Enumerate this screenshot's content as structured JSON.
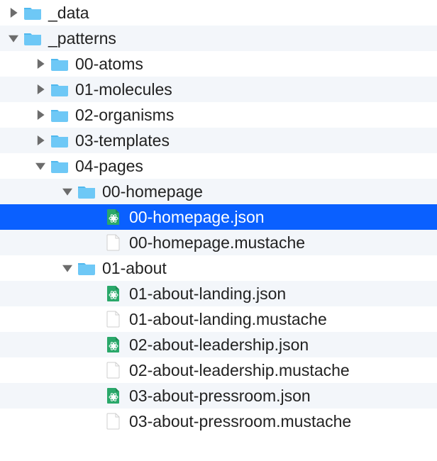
{
  "colors": {
    "selection": "#0a60ff",
    "folder": "#6ec8f6",
    "folder_tab": "#4fb8ee",
    "arrow": "#6c6c6c",
    "json_icon": "#2aa86a",
    "file_page": "#ffffff",
    "file_outline": "#cfcfcf",
    "row_stripe": "#f3f6fa"
  },
  "rows": [
    {
      "depth": 0,
      "arrow": "right",
      "icon": "folder",
      "label": "_data",
      "selected": false
    },
    {
      "depth": 0,
      "arrow": "down",
      "icon": "folder",
      "label": "_patterns",
      "selected": false
    },
    {
      "depth": 1,
      "arrow": "right",
      "icon": "folder",
      "label": "00-atoms",
      "selected": false
    },
    {
      "depth": 1,
      "arrow": "right",
      "icon": "folder",
      "label": "01-molecules",
      "selected": false
    },
    {
      "depth": 1,
      "arrow": "right",
      "icon": "folder",
      "label": "02-organisms",
      "selected": false
    },
    {
      "depth": 1,
      "arrow": "right",
      "icon": "folder",
      "label": "03-templates",
      "selected": false
    },
    {
      "depth": 1,
      "arrow": "down",
      "icon": "folder",
      "label": "04-pages",
      "selected": false
    },
    {
      "depth": 2,
      "arrow": "down",
      "icon": "folder",
      "label": "00-homepage",
      "selected": false
    },
    {
      "depth": 3,
      "arrow": "none",
      "icon": "json",
      "label": "00-homepage.json",
      "selected": true
    },
    {
      "depth": 3,
      "arrow": "none",
      "icon": "mustache",
      "label": "00-homepage.mustache",
      "selected": false
    },
    {
      "depth": 2,
      "arrow": "down",
      "icon": "folder",
      "label": "01-about",
      "selected": false
    },
    {
      "depth": 3,
      "arrow": "none",
      "icon": "json",
      "label": "01-about-landing.json",
      "selected": false
    },
    {
      "depth": 3,
      "arrow": "none",
      "icon": "mustache",
      "label": "01-about-landing.mustache",
      "selected": false
    },
    {
      "depth": 3,
      "arrow": "none",
      "icon": "json",
      "label": "02-about-leadership.json",
      "selected": false
    },
    {
      "depth": 3,
      "arrow": "none",
      "icon": "mustache",
      "label": "02-about-leadership.mustache",
      "selected": false
    },
    {
      "depth": 3,
      "arrow": "none",
      "icon": "json",
      "label": "03-about-pressroom.json",
      "selected": false
    },
    {
      "depth": 3,
      "arrow": "none",
      "icon": "mustache",
      "label": "03-about-pressroom.mustache",
      "selected": false
    }
  ]
}
